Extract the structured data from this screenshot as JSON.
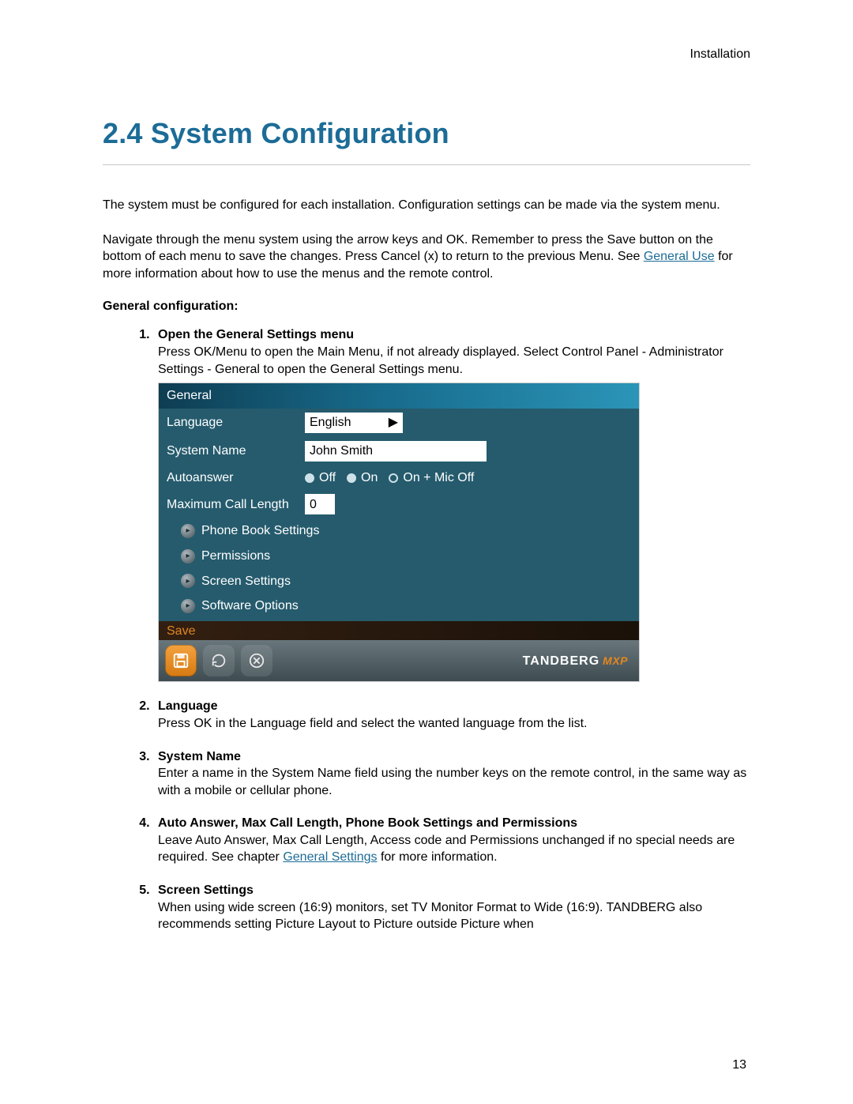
{
  "header": {
    "breadcrumb": "Installation"
  },
  "title": "2.4 System Configuration",
  "intro_p1": "The system must be configured for each installation. Configuration settings can be made via the system menu.",
  "intro_p2_a": "Navigate through the menu system using the arrow keys and OK. Remember to press the Save button on the bottom of each menu to save the changes. Press Cancel (x) to return to the previous Menu. See ",
  "intro_p2_link": "General Use",
  "intro_p2_b": " for more information about how to use the menus and the remote control.",
  "subheading": "General configuration:",
  "steps": {
    "s1_title": "Open the General Settings menu",
    "s1_body": "Press OK/Menu to open the Main Menu, if not already displayed. Select Control Panel - Administrator Settings - General to open the General Settings menu.",
    "s2_title": "Language",
    "s2_body": "Press OK in the Language field and select the wanted language from the list.",
    "s3_title": "System Name",
    "s3_body": "Enter a name in the System Name field using the number keys on the remote control, in the same way as with a mobile or cellular phone.",
    "s4_title": "Auto Answer, Max Call Length, Phone Book Settings and Permissions",
    "s4_body_a": "Leave Auto Answer, Max Call Length, Access code and Permissions unchanged if no special needs are required. See chapter ",
    "s4_link": "General Settings",
    "s4_body_b": " for more information.",
    "s5_title": "Screen Settings",
    "s5_body": "When using wide screen (16:9) monitors, set TV Monitor Format to Wide (16:9). TANDBERG also recommends setting Picture Layout to Picture outside Picture when"
  },
  "menu": {
    "header": "General",
    "rows": {
      "language_label": "Language",
      "language_value": "English",
      "sysname_label": "System Name",
      "sysname_value": "John Smith",
      "autoanswer_label": "Autoanswer",
      "autoanswer_opts": {
        "off": "Off",
        "on": "On",
        "onmic": "On + Mic Off"
      },
      "maxcall_label": "Maximum Call Length",
      "maxcall_value": "0"
    },
    "subitems": {
      "phonebook": "Phone Book Settings",
      "permissions": "Permissions",
      "screen": "Screen Settings",
      "software": "Software Options"
    },
    "save_label": "Save",
    "brand_main": "TANDBERG",
    "brand_suffix": "MXP"
  },
  "page_number": "13"
}
